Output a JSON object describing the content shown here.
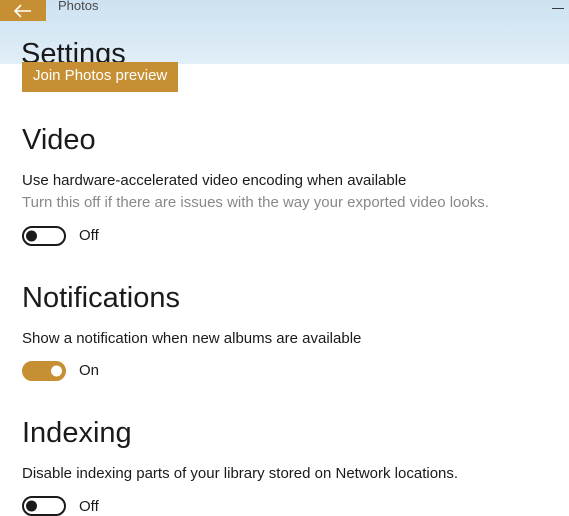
{
  "titlebar": {
    "app_name": "Photos"
  },
  "page_title": "Settings",
  "preview": {
    "button_label": "Join Photos preview"
  },
  "video": {
    "heading": "Video",
    "label": "Use hardware-accelerated video encoding when available",
    "desc": "Turn this off if there are issues with the way your exported video looks.",
    "state": "Off"
  },
  "notifications": {
    "heading": "Notifications",
    "label": "Show a notification when new albums are available",
    "state": "On"
  },
  "indexing": {
    "heading": "Indexing",
    "label": "Disable indexing parts of your library stored on Network locations.",
    "state": "Off"
  },
  "colors": {
    "accent": "#c78f33"
  }
}
